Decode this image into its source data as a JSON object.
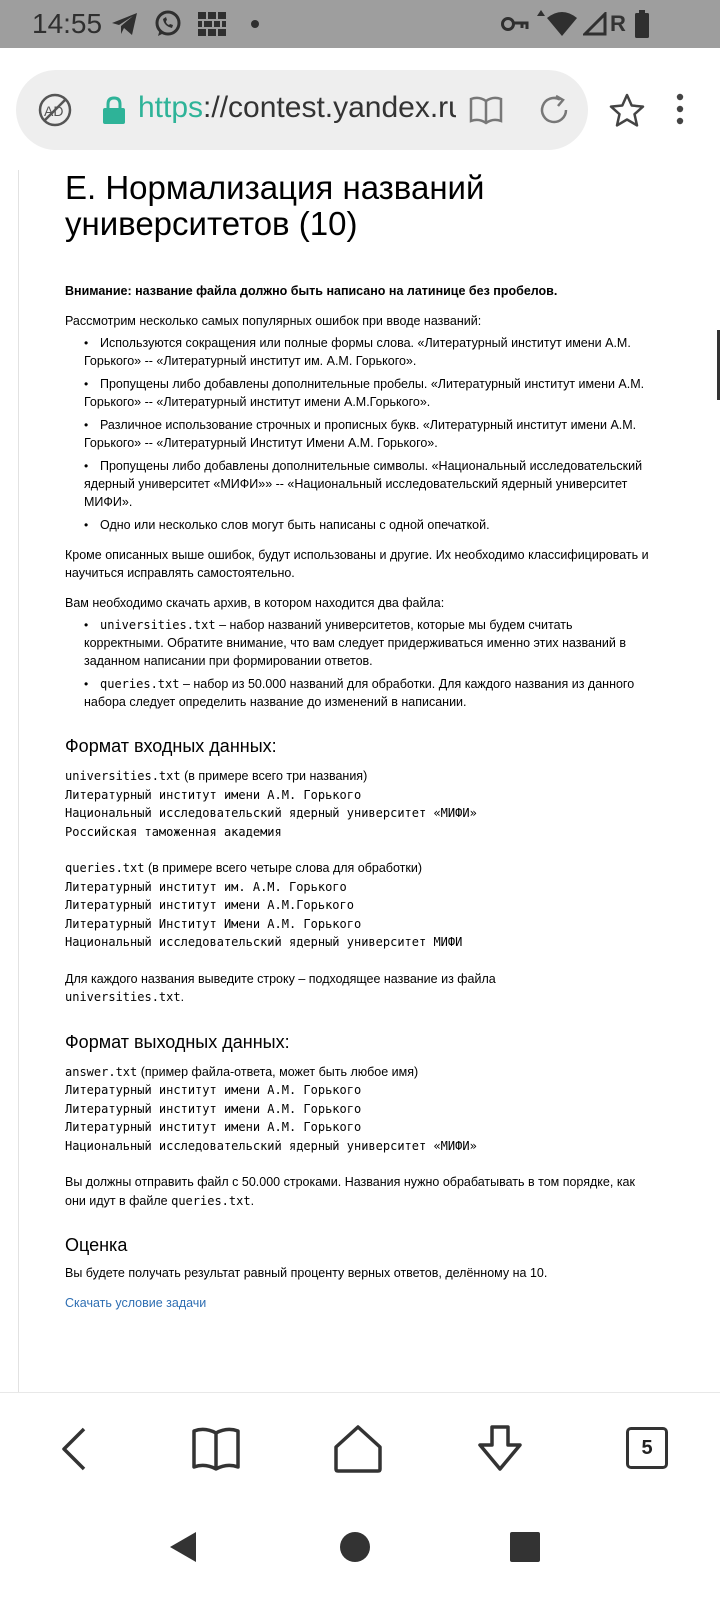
{
  "status_bar": {
    "time": "14:55",
    "left_icons": [
      "telegram-icon",
      "whatsapp-icon",
      "wall-icon",
      "dot-icon"
    ],
    "right_icons": [
      "vpn-key-icon",
      "wifi-icon",
      "signal-icon",
      "battery-icon"
    ],
    "roaming": "R"
  },
  "browser": {
    "url_scheme": "https",
    "url_rest": "://contest.yandex.ru",
    "icons": [
      "adblock-icon",
      "lock-icon",
      "reader-mode-icon",
      "reload-icon",
      "star-icon",
      "menu-icon"
    ]
  },
  "article": {
    "title": "E. Нормализация названий университетов (10)",
    "warning": "Внимание: название файла должно быть написано на латинице без пробелов.",
    "intro": "Рассмотрим несколько самых популярных ошибок при вводе названий:",
    "errors": [
      "Используются сокращения или полные формы слова. «Литературный институт имени А.М. Горького» -- «Литературный институт им. А.М. Горького».",
      "Пропущены либо добавлены дополнительные пробелы. «Литературный институт имени А.М. Горького» -- «Литературный институт имени А.М.Горького».",
      "Различное использование строчных и прописных букв. «Литературный институт имени А.М. Горького» -- «Литературный Институт Имени А.М. Горького».",
      "Пропущены либо добавлены дополнительные символы. «Национальный исследовательский ядерный университет «МИФИ»» -- «Национальный исследовательский ядерный университет МИФИ».",
      "Одно или несколько слов могут быть написаны с одной опечаткой."
    ],
    "other_errors": "Кроме описанных выше ошибок, будут использованы и другие. Их необходимо классифицировать и научиться исправлять самостоятельно.",
    "archive_intro": "Вам необходимо скачать архив, в котором находится два файла:",
    "files": [
      {
        "name": "universities.txt",
        "desc": " – набор названий университетов, которые мы будем считать корректными. Обратите внимание, что вам следует придерживаться именно этих названий в заданном написании при формировании ответов."
      },
      {
        "name": "queries.txt",
        "desc": " – набор из 50.000 названий для обработки. Для каждого названия из данного набора следует определить название до изменений в написании."
      }
    ],
    "input_heading": "Формат входных данных:",
    "input_universities_file": "universities.txt",
    "input_universities_note": " (в примере всего три названия)",
    "input_universities_lines": [
      "Литературный институт имени А.М. Горького",
      "Национальный исследовательский ядерный университет «МИФИ»",
      "Российская таможенная академия"
    ],
    "input_queries_file": "queries.txt",
    "input_queries_note": " (в примере всего четыре слова для обработки)",
    "input_queries_lines": [
      "Литературный институт им. А.М. Горького",
      "Литературный институт имени А.М.Горького",
      "Литературный Институт Имени А.М. Горького",
      "Национальный исследовательский ядерный университет МИФИ"
    ],
    "input_instruction": "Для каждого названия выведите строку – подходящее название из файла",
    "input_instruction_file": "universities.txt",
    "input_instruction_end": ".",
    "output_heading": "Формат выходных данных:",
    "output_file": "answer.txt",
    "output_note": " (пример файла-ответа, может быть любое имя)",
    "output_lines": [
      "Литературный институт имени А.М. Горького",
      "Литературный институт имени А.М. Горького",
      "Литературный институт имени А.М. Горького",
      "Национальный исследовательский ядерный университет «МИФИ»"
    ],
    "output_instruction": "Вы должны отправить файл с 50.000 строками. Названия нужно обрабатывать в том порядке, как они идут в файле ",
    "output_instruction_file": "queries.txt",
    "output_instruction_end": ".",
    "score_heading": "Оценка",
    "score_text": "Вы будете получать результат равный проценту верных ответов, делённому на 10.",
    "download_link": "Скачать условие задачи"
  },
  "bottom_nav": {
    "icons": [
      "back-icon",
      "bookmarks-icon",
      "home-icon",
      "download-icon"
    ],
    "tab_count": "5"
  },
  "system_nav": {
    "icons": [
      "system-back-icon",
      "system-home-icon",
      "system-recents-icon"
    ]
  },
  "colors": {
    "status_bar": "#9e9e9e",
    "url_scheme": "#2eb398",
    "lock": "#2eb398",
    "link": "#2f6fb3"
  }
}
